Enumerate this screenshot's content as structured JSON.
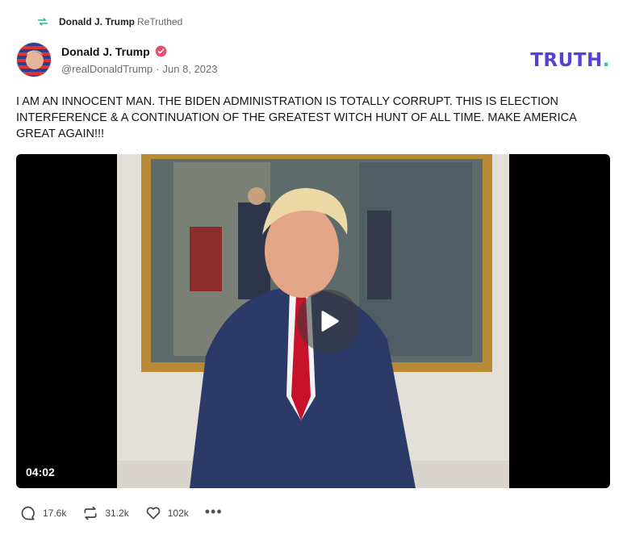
{
  "retruth": {
    "name": "Donald J. Trump",
    "label": "ReTruthed"
  },
  "author": {
    "name": "Donald J. Trump",
    "handle": "@realDonaldTrump",
    "date": "Jun 8, 2023"
  },
  "brand": {
    "logo_main": "TRUTH",
    "logo_dot": ".",
    "color": "#5a3fd6",
    "accent": "#19d0b4"
  },
  "post": {
    "text": "I AM AN INNOCENT MAN. THE BIDEN ADMINISTRATION IS TOTALLY CORRUPT. THIS IS ELECTION INTERFERENCE & A CONTINUATION OF THE GREATEST WITCH HUNT OF ALL TIME. MAKE AMERICA GREAT AGAIN!!!"
  },
  "video": {
    "duration": "04:02"
  },
  "actions": {
    "replies": "17.6k",
    "retruths": "31.2k",
    "likes": "102k",
    "more": "•••"
  },
  "icons": {
    "retruth": "retruth-icon",
    "verified": "verified-badge-icon",
    "reply": "reply-bubble-icon",
    "like": "heart-icon",
    "play": "play-icon"
  }
}
